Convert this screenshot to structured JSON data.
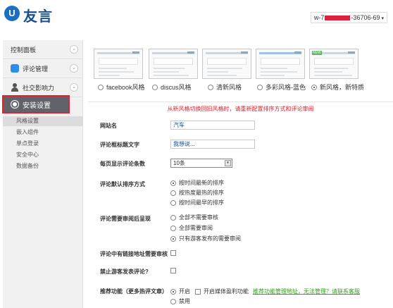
{
  "header": {
    "logo_text": "友言",
    "account_prefix": "w-7",
    "account_suffix": "-36706-69",
    "dropdown_glyph": "▾"
  },
  "sidebar": {
    "items": [
      {
        "label": "控制面板",
        "icon": "none"
      },
      {
        "label": "评论管理",
        "icon": "speech-bubble-icon"
      },
      {
        "label": "社交影响力",
        "icon": "user-icon"
      }
    ],
    "active": {
      "label": "安装设置",
      "icon": "gear-icon"
    },
    "subitems": [
      {
        "label": "风格设置",
        "selected": true
      },
      {
        "label": "嵌入组件",
        "selected": false
      },
      {
        "label": "单点登录",
        "selected": false
      },
      {
        "label": "安全中心",
        "selected": false
      },
      {
        "label": "数据备份",
        "selected": false
      }
    ],
    "chevron_glyph": "⌄"
  },
  "themes": {
    "options": [
      {
        "label": "facebook风格",
        "selected": false
      },
      {
        "label": "discus风格",
        "selected": false
      },
      {
        "label": "清新风格",
        "selected": false
      },
      {
        "label": "多彩风格-蓝色",
        "selected": false
      },
      {
        "label": "新风格，新特质",
        "selected": true,
        "badge": "NEW"
      }
    ]
  },
  "warning": "从新风格切换回旧风格时，请重新配置排序方式和评论审阅",
  "settings": {
    "site_name": {
      "label": "网站名",
      "value": "汽车"
    },
    "comment_box_text": {
      "label": "评论框标题文字",
      "value": "我想说..."
    },
    "per_page": {
      "label": "每页显示评论条数",
      "value": "10条",
      "arrow": "▾"
    },
    "sort": {
      "label": "评论默认排序方式",
      "options": [
        {
          "label": "按时间最新的排序",
          "selected": true
        },
        {
          "label": "按热度最热的排序",
          "selected": false
        },
        {
          "label": "按时间最早的排序",
          "selected": false
        }
      ]
    },
    "review": {
      "label": "评论需要审阅后呈现",
      "options": [
        {
          "label": "全部不需要审核",
          "selected": false
        },
        {
          "label": "全部需要审阅",
          "selected": false
        },
        {
          "label": "只有游客发布的需要审阅",
          "selected": true
        }
      ]
    },
    "link_review": {
      "label": "评论中有链接地址需要审核",
      "checked": false
    },
    "guest_ban": {
      "label": "禁止游客发表评论?",
      "checked": false
    },
    "recommend": {
      "label": "推荐功能（更多热评文章）",
      "on_label": "开启",
      "off_label": "禁用",
      "on_selected": true,
      "media_label": "开启媒体盈利功能",
      "help_link": "推荐功能管理地址，无法管理？请联系客服"
    }
  }
}
